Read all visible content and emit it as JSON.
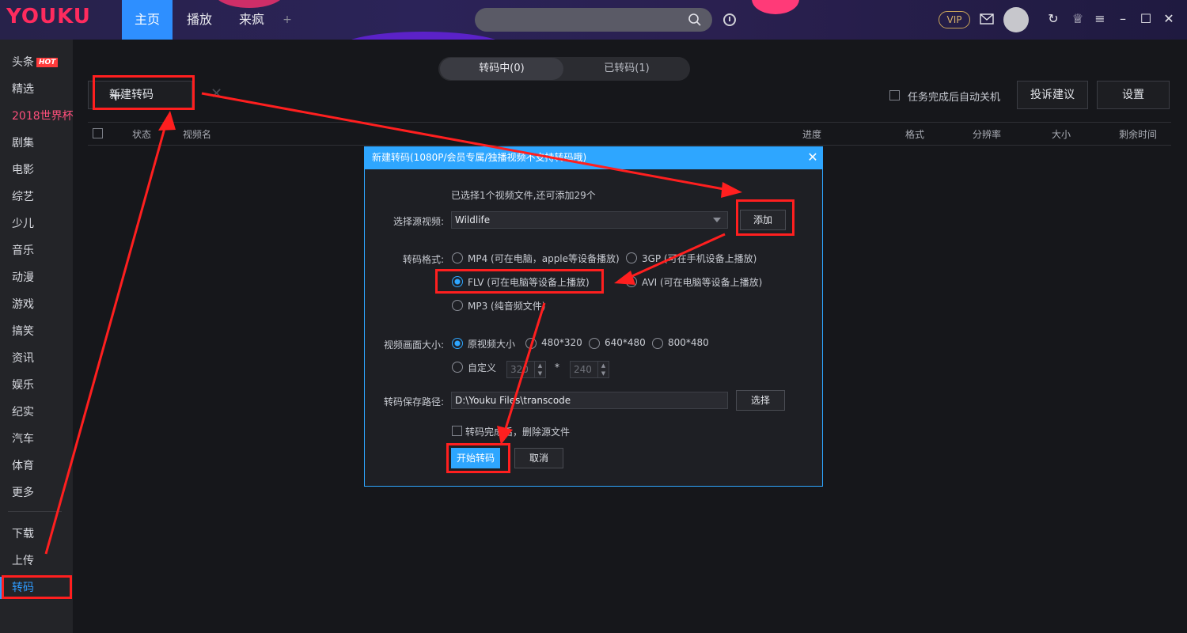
{
  "header": {
    "logo": "YOUKU",
    "tabs": [
      {
        "label": "主页",
        "active": true
      },
      {
        "label": "播放",
        "active": false
      },
      {
        "label": "来疯",
        "active": false
      }
    ],
    "add_tab": "+",
    "vip_label": "VIP"
  },
  "sidebar": {
    "items": [
      {
        "label": "头条",
        "badge": "HOT"
      },
      {
        "label": "精选"
      },
      {
        "label": "2018世界杯",
        "highlight": true
      },
      {
        "label": "剧集"
      },
      {
        "label": "电影"
      },
      {
        "label": "综艺"
      },
      {
        "label": "少儿"
      },
      {
        "label": "音乐"
      },
      {
        "label": "动漫"
      },
      {
        "label": "游戏"
      },
      {
        "label": "搞笑"
      },
      {
        "label": "资讯"
      },
      {
        "label": "娱乐"
      },
      {
        "label": "纪实"
      },
      {
        "label": "汽车"
      },
      {
        "label": "体育"
      },
      {
        "label": "更多"
      }
    ],
    "bottom_items": [
      {
        "label": "下载"
      },
      {
        "label": "上传"
      },
      {
        "label": "转码",
        "active": true
      }
    ]
  },
  "main": {
    "segments": [
      "转码中(0)",
      "已转码(1)"
    ],
    "new_transcode_label": "新建转码",
    "auto_shutdown_label": "任务完成后自动关机",
    "complaint_label": "投诉建议",
    "settings_label": "设置",
    "columns": [
      "状态",
      "视频名",
      "进度",
      "格式",
      "分辨率",
      "大小",
      "剩余时间"
    ]
  },
  "dialog": {
    "title": "新建转码(1080P/会员专属/独播视频不支持转码哦)",
    "selection_info": "已选择1个视频文件,还可添加29个",
    "source_label": "选择源视频:",
    "source_value": "Wildlife",
    "add_label": "添加",
    "format_label": "转码格式:",
    "formats": [
      {
        "label": "MP4 (可在电脑，apple等设备播放)",
        "selected": false
      },
      {
        "label": "3GP (可在手机设备上播放)",
        "selected": false
      },
      {
        "label": "FLV  (可在电脑等设备上播放)",
        "selected": true
      },
      {
        "label": "AVI  (可在电脑等设备上播放)",
        "selected": false
      },
      {
        "label": "MP3 (纯音频文件)",
        "selected": false
      }
    ],
    "size_label": "视频画面大小:",
    "sizes": [
      {
        "label": "原视频大小",
        "selected": true
      },
      {
        "label": "480*320",
        "selected": false
      },
      {
        "label": "640*480",
        "selected": false
      },
      {
        "label": "800*480",
        "selected": false
      }
    ],
    "custom_label": "自定义",
    "custom_width": "320",
    "custom_sep": "*",
    "custom_height": "240",
    "path_label": "转码保存路径:",
    "path_value": "D:\\Youku Files\\transcode",
    "browse_label": "选择",
    "delete_source_label": "转码完成后，删除源文件",
    "start_label": "开始转码",
    "cancel_label": "取消"
  },
  "colors": {
    "accent": "#2ea6ff",
    "annotation": "#ff1f1f",
    "hot_badge": "#ff3b3b",
    "highlight_text": "#ff4f7c"
  }
}
